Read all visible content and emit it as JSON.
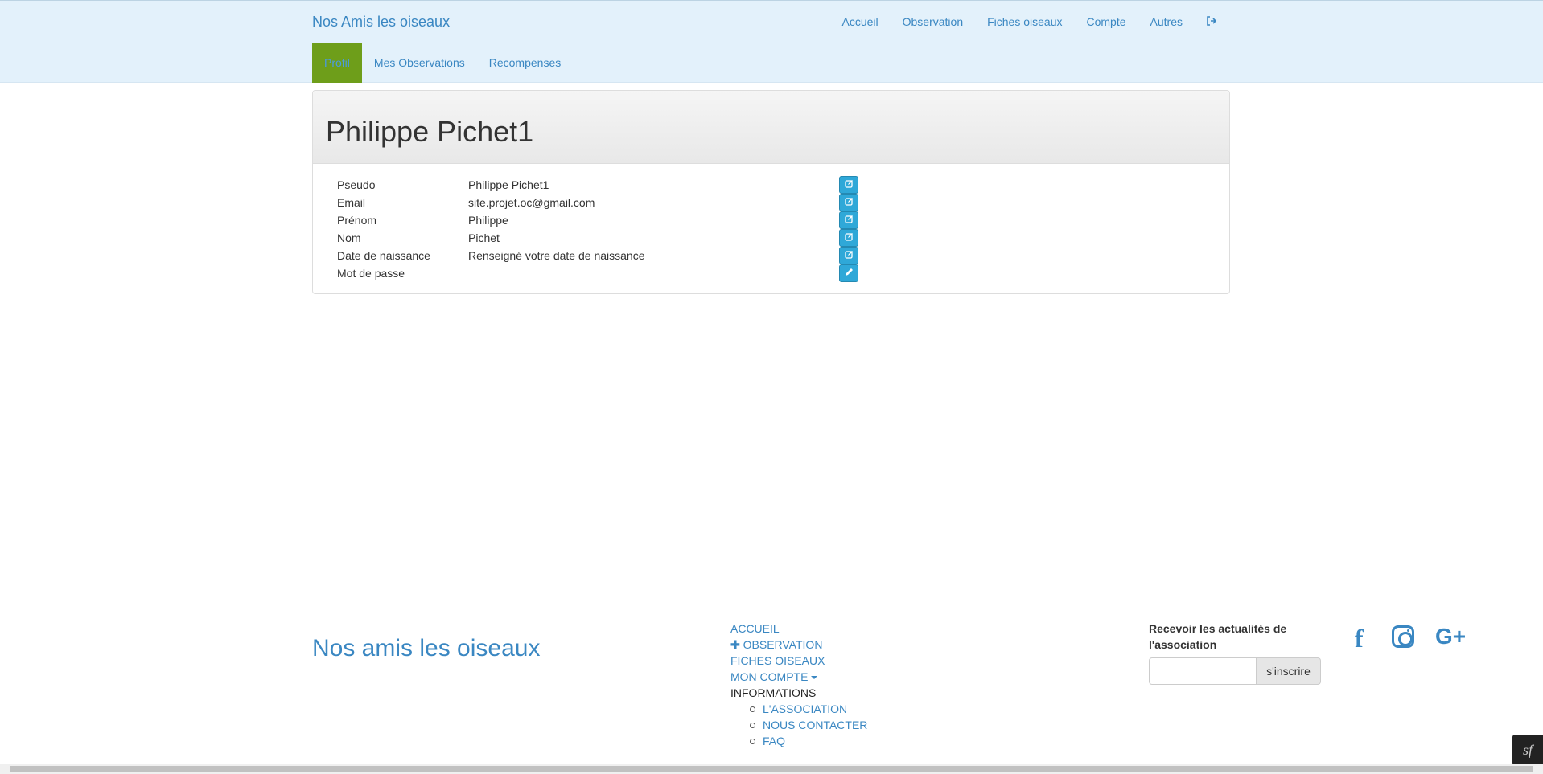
{
  "header": {
    "brand": "Nos Amis les oiseaux",
    "nav": [
      "Accueil",
      "Observation",
      "Fiches oiseaux",
      "Compte",
      "Autres"
    ],
    "logout_icon": "sign-out-icon"
  },
  "subnav": {
    "tabs": [
      "Profil",
      "Mes Observations",
      "Recompenses"
    ],
    "active": "Profil"
  },
  "profile": {
    "title": "Philippe Pichet1",
    "fields": [
      {
        "label": "Pseudo",
        "value": "Philippe Pichet1",
        "icon": "edit-icon"
      },
      {
        "label": "Email",
        "value": "site.projet.oc@gmail.com",
        "icon": "edit-icon"
      },
      {
        "label": "Prénom",
        "value": "Philippe",
        "icon": "edit-icon"
      },
      {
        "label": "Nom",
        "value": "Pichet",
        "icon": "edit-icon"
      },
      {
        "label": "Date de naissance",
        "value": "Renseigné votre date de naissance",
        "icon": "edit-icon"
      },
      {
        "label": "Mot de passe",
        "value": "",
        "icon": "pencil-icon"
      }
    ]
  },
  "footer": {
    "brand": "Nos amis les oiseaux",
    "links": {
      "accueil": "ACCUEIL",
      "observation": "OBSERVATION",
      "fiches": "FICHES OISEAUX",
      "compte": "MON COMPTE",
      "informations": "INFORMATIONS",
      "association": "L'ASSOCIATION",
      "contact": "NOUS CONTACTER",
      "faq": "FAQ"
    },
    "newsletter": {
      "title": "Recevoir les actualités de l'association",
      "input_value": "",
      "button": "s'inscrire"
    },
    "social": {
      "facebook": "f",
      "instagram": "instagram-icon",
      "google_plus": "G+"
    }
  },
  "colors": {
    "link": "#3a87c2",
    "header_bg": "#e3f1fb",
    "active_tab": "#6e9e1a",
    "edit_button": "#2fa8d8"
  }
}
